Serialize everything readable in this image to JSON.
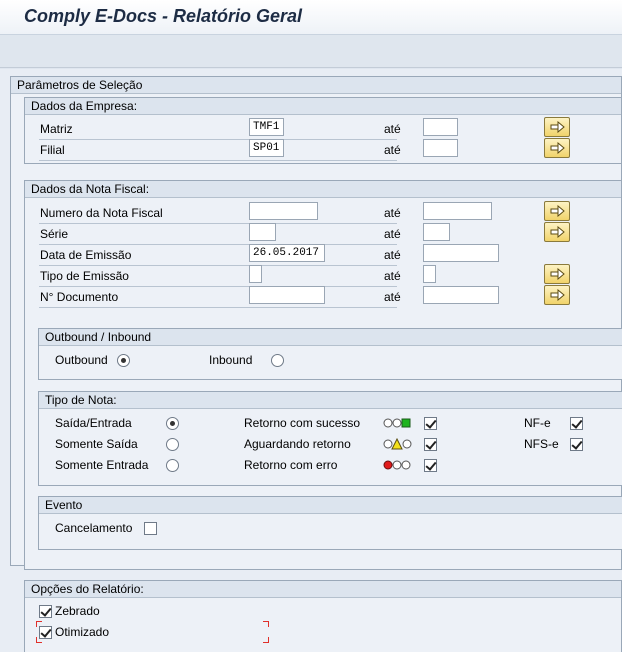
{
  "app": {
    "title": "Comply E-Docs - Relatório Geral"
  },
  "params": {
    "title": "Parâmetros de Seleção"
  },
  "empresa": {
    "title": "Dados da Empresa:",
    "until_label": "até",
    "rows": [
      {
        "label": "Matriz",
        "value": "TMF1",
        "to": ""
      },
      {
        "label": "Filial",
        "value": "SP01",
        "to": ""
      }
    ]
  },
  "nota": {
    "title": "Dados da Nota Fiscal:",
    "until_label": "até",
    "rows": [
      {
        "label": "Numero da Nota Fiscal",
        "value": "",
        "to": ""
      },
      {
        "label": "Série",
        "value": "",
        "to": ""
      },
      {
        "label": "Data de Emissão",
        "value": "26.05.2017",
        "to": ""
      },
      {
        "label": "Tipo de Emissão",
        "value": "",
        "to": ""
      },
      {
        "label": "N° Documento",
        "value": "",
        "to": ""
      }
    ]
  },
  "direction": {
    "title": "Outbound / Inbound",
    "outbound": "Outbound",
    "inbound": "Inbound",
    "selected": "outbound"
  },
  "tipo": {
    "title": "Tipo de Nota:",
    "options": [
      "Saída/Entrada",
      "Somente Saída",
      "Somente Entrada"
    ],
    "selected_index": 0,
    "status": [
      {
        "label": "Retorno com sucesso",
        "light": "green",
        "checked": true
      },
      {
        "label": "Aguardando retorno",
        "light": "yellow",
        "checked": true
      },
      {
        "label": "Retorno com erro",
        "light": "red",
        "checked": true
      }
    ],
    "docs": [
      {
        "label": "NF-e",
        "checked": true
      },
      {
        "label": "NFS-e",
        "checked": true
      }
    ]
  },
  "evento": {
    "title": "Evento",
    "cancel_label": "Cancelamento",
    "cancel_checked": false
  },
  "opcoes": {
    "title": "Opções do Relatório:",
    "zebrado": "Zebrado",
    "otimizado": "Otimizado",
    "zebrado_checked": true,
    "otimizado_checked": true
  },
  "icons": {
    "multi_select": "arrow-right-icon",
    "status_green": "#1db31d",
    "status_yellow": "#f3e01a",
    "status_red": "#e01b1b"
  }
}
